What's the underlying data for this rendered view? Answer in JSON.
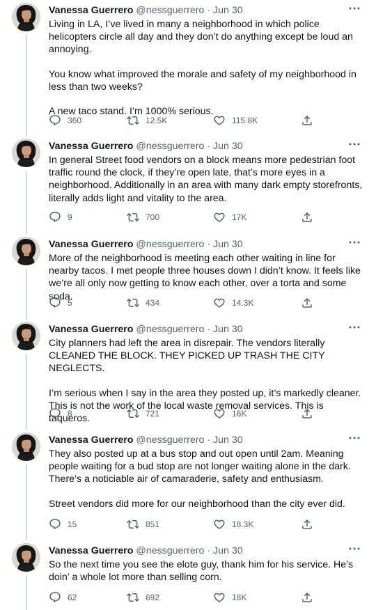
{
  "author": {
    "name": "Vanessa Guerrero",
    "handle": "@nessguerrero",
    "separator": "·"
  },
  "icons": {
    "more": "more-horizontal-icon",
    "reply": "reply-bubble-icon",
    "retweet": "retweet-icon",
    "like": "heart-icon",
    "share": "share-upload-icon"
  },
  "colors": {
    "text": "#0f1419",
    "secondary": "#536471",
    "thread_line": "#cfd9de"
  },
  "tweets": [
    {
      "date": "Jun 30",
      "paragraphs": [
        "Living in LA, I’ve lived in many a neighborhood in which police helicopters circle all day and they don’t do anything except be loud an annoying.",
        "You know what improved the morale and safety of my neighborhood in less than two weeks?",
        "A new taco stand. I’m 1000% serious."
      ],
      "replies": "360",
      "retweets": "12.5K",
      "likes": "115.8K"
    },
    {
      "date": "Jun 30",
      "paragraphs": [
        "In general Street food vendors on a block means more pedestrian foot traffic round the clock, if they’re open late, that’s more eyes in a neighborhood. Additionally in an area with many dark empty storefronts, literally adds light and vitality to the area."
      ],
      "replies": "9",
      "retweets": "700",
      "likes": "17K"
    },
    {
      "date": "Jun 30",
      "paragraphs": [
        "More of the neighborhood is meeting each other waiting in line for nearby tacos. I met people three houses down I didn’t know. It feels like we’re all only now getting to know each other, over a torta and some soda."
      ],
      "replies": "5",
      "retweets": "434",
      "likes": "14.3K"
    },
    {
      "date": "Jun 30",
      "paragraphs": [
        "City planners had left the area in disrepair. The vendors literally CLEANED THE BLOCK. THEY PICKED UP TRASH THE CITY NEGLECTS.",
        "I’m serious when I say in the area they posted up, it’s markedly cleaner. This is not the work of the local waste removal services. This is taqueros."
      ],
      "replies": "8",
      "retweets": "721",
      "likes": "16K"
    },
    {
      "date": "Jun 30",
      "paragraphs": [
        "They also posted up at a bus stop and out open until 2am. Meaning people waiting for a bud stop are not longer waiting alone in the dark. There’s a noticiable air of camaraderie, safety and enthusiasm.",
        "Street vendors did more for our neighborhood than the city ever did."
      ],
      "replies": "15",
      "retweets": "851",
      "likes": "18.3K"
    },
    {
      "date": "Jun 30",
      "paragraphs": [
        "So the next time you see the elote guy, thank him for his service. He’s doin’ a whole lot more than selling corn."
      ],
      "replies": "62",
      "retweets": "692",
      "likes": "18K"
    }
  ]
}
